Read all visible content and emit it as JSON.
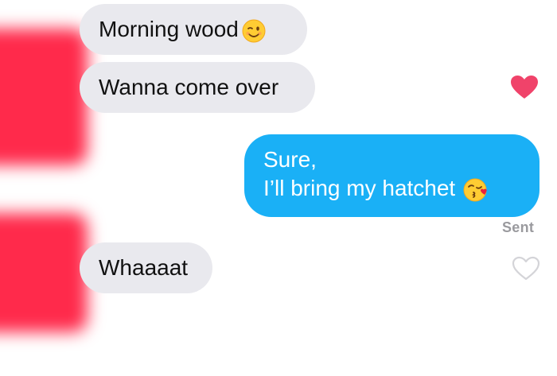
{
  "messages": [
    {
      "direction": "incoming",
      "text": "Morning wood",
      "emoji": "winking-face"
    },
    {
      "direction": "incoming",
      "text": "Wanna come over",
      "liked": true
    },
    {
      "direction": "outgoing",
      "lines": [
        "Sure,",
        "I’ll bring my hatchet"
      ],
      "emoji": "face-blowing-kiss",
      "status": "Sent"
    },
    {
      "direction": "incoming",
      "text": "Whaaaat",
      "liked": false
    }
  ],
  "colors": {
    "incoming_bubble": "#e9e9ee",
    "outgoing_bubble": "#1ab0f6",
    "like_heart": "#f0436a",
    "avatar_redaction": "#ff2a4b",
    "status_text": "#9a9a9e"
  },
  "icons": {
    "liked": "heart-filled-icon",
    "not_liked": "heart-outline-icon"
  }
}
